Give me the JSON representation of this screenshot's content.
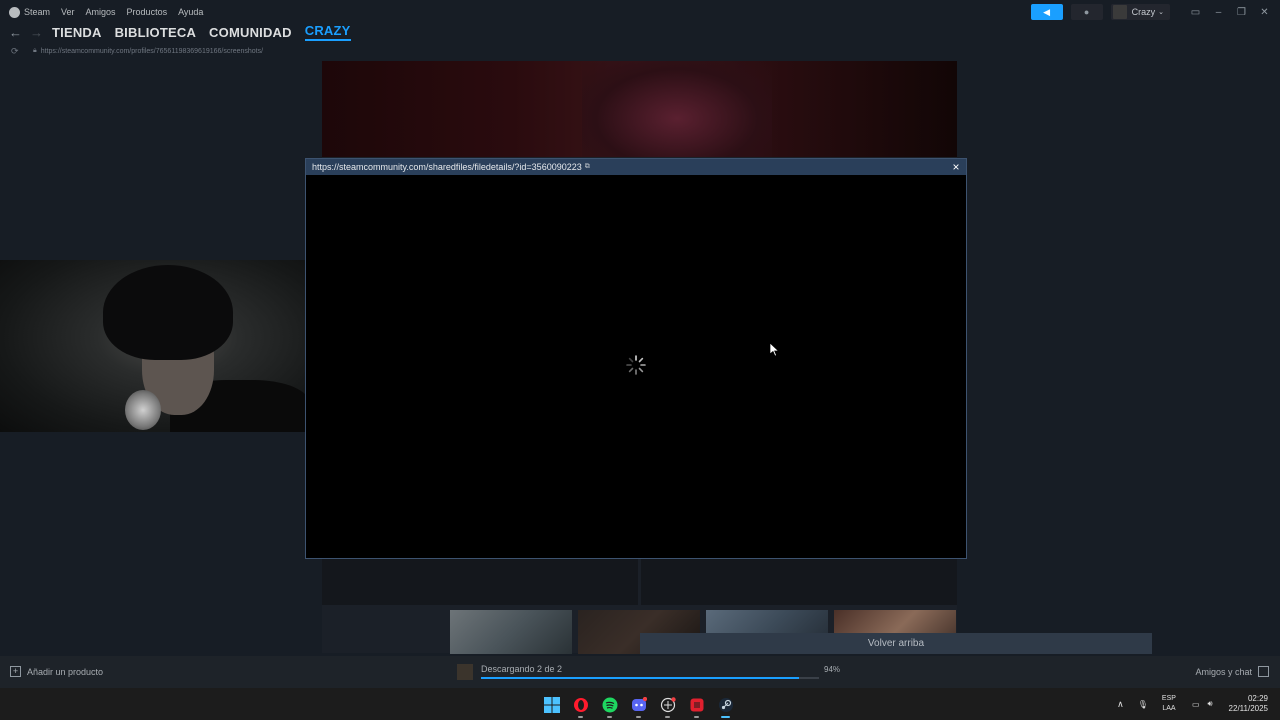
{
  "menubar": {
    "items": [
      "Steam",
      "Ver",
      "Amigos",
      "Productos",
      "Ayuda"
    ],
    "user_name": "Crazy",
    "announce_icon": "megaphone-icon",
    "bell_icon": "bell-icon"
  },
  "nav": {
    "tabs": [
      "TIENDA",
      "BIBLIOTECA",
      "COMUNIDAD",
      "CRAZY"
    ],
    "active_tab": "CRAZY"
  },
  "url": "https://steamcommunity.com/profiles/76561198369619166/screenshots/",
  "modal": {
    "url": "https://steamcommunity.com/sharedfiles/filedetails/?id=3560090223",
    "ext_icon": "⧉",
    "close_label": "×"
  },
  "page": {
    "back_to_top": "Volver arriba"
  },
  "bottombar": {
    "add_product": "Añadir un producto",
    "download_status": "Descargando 2 de 2",
    "download_percent_label": "94%",
    "download_progress": 0.94,
    "friends_chat": "Amigos y chat"
  },
  "taskbar": {
    "lang_top": "ESP",
    "lang_bottom": "LAA",
    "time": "02:29",
    "date": "22/11/2025"
  },
  "colors": {
    "accent": "#1a9fff",
    "background": "#171d25",
    "modal_header": "#2a3f5a"
  }
}
